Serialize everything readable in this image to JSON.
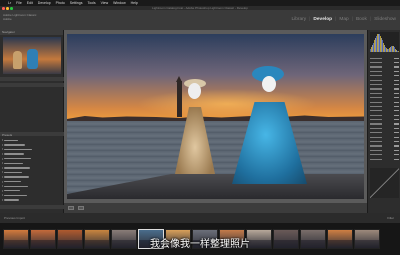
{
  "menubar": {
    "items": [
      "Lr",
      "File",
      "Edit",
      "Develop",
      "Photo",
      "Settings",
      "Tools",
      "View",
      "Window",
      "Help"
    ]
  },
  "window": {
    "title": "Lightroom Catalog.lrcat - Adobe Photoshop Lightroom Classic - Develop"
  },
  "identity": {
    "line1": "Adobe Lightroom Classic",
    "line2": "Adobe"
  },
  "modules": {
    "items": [
      {
        "label": "Library",
        "active": false
      },
      {
        "label": "Develop",
        "active": true
      },
      {
        "label": "Map",
        "active": false
      },
      {
        "label": "Book",
        "active": false
      },
      {
        "label": "Slideshow",
        "active": false
      }
    ]
  },
  "left_panel": {
    "navigator_label": "Navigator",
    "presets_label": "Presets"
  },
  "filmstrip": {
    "source_label": "Previous Import",
    "filter_label": "Filter"
  },
  "caption": "我会像我一样整理照片",
  "colors": {
    "app_bg": "#2d2d2d",
    "center_bg": "#5b5b5b",
    "active_module": "#e6e6e6"
  }
}
